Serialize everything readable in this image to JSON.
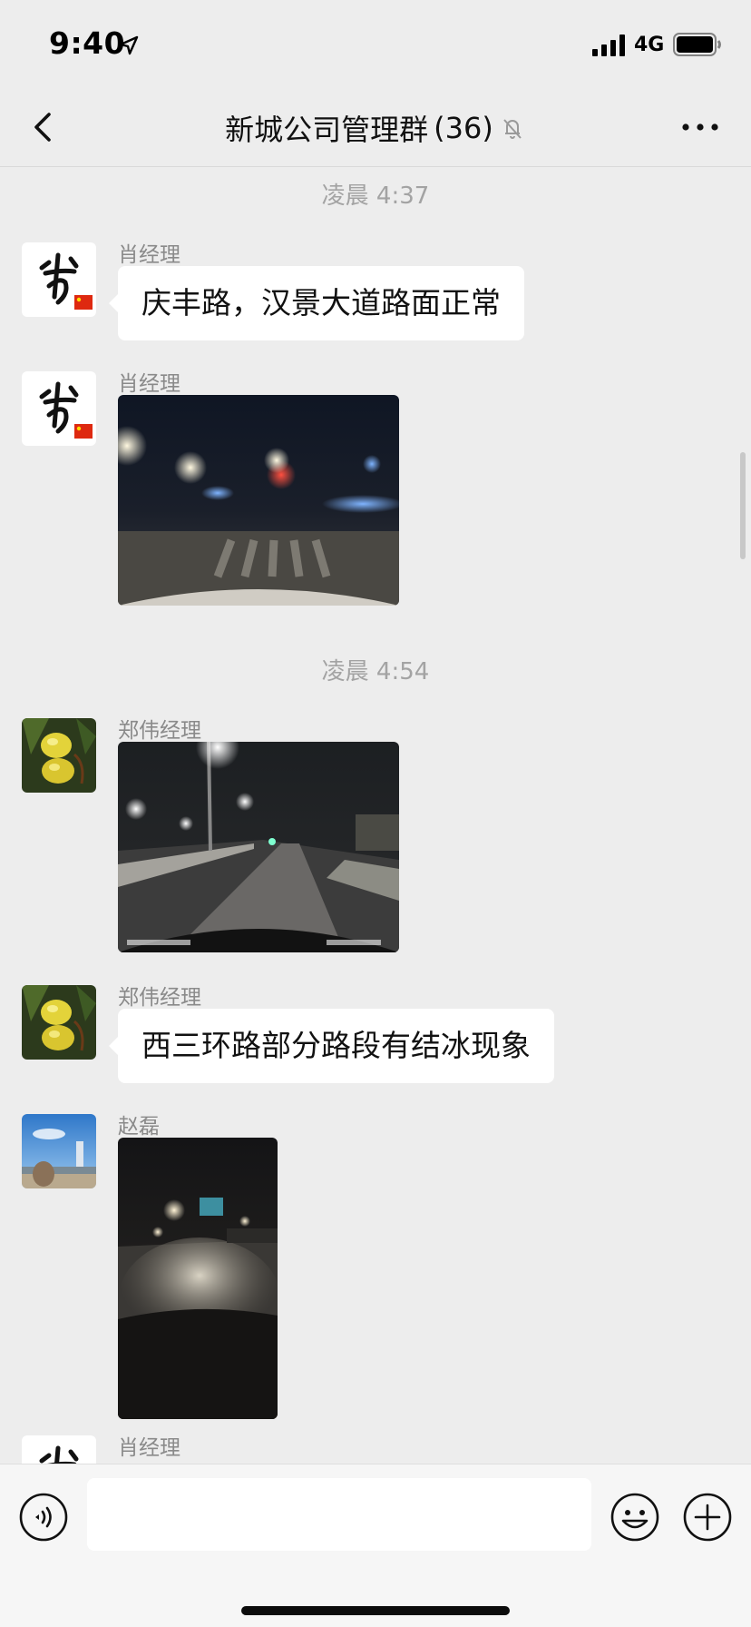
{
  "status_bar": {
    "time": "9:40",
    "network": "4G"
  },
  "nav": {
    "title": "新城公司管理群",
    "member_count": "(36)"
  },
  "chat": {
    "time_separators": [
      "凌晨 4:37",
      "凌晨 4:54"
    ],
    "messages": [
      {
        "sender": "肖经理",
        "type": "text",
        "text": "庆丰路，汉景大道路面正常",
        "avatar": "signature-avatar"
      },
      {
        "sender": "肖经理",
        "type": "image",
        "image": "night-intersection-photo",
        "avatar": "signature-avatar"
      },
      {
        "sender": "郑伟经理",
        "type": "image",
        "image": "night-road-streetlights-photo",
        "avatar": "yellow-fruit-avatar"
      },
      {
        "sender": "郑伟经理",
        "type": "text",
        "text": "西三环路部分路段有结冰现象",
        "avatar": "yellow-fruit-avatar"
      },
      {
        "sender": "赵磊",
        "type": "image",
        "image": "night-road-headlights-photo",
        "avatar": "seaside-avatar"
      },
      {
        "sender": "肖经理",
        "type": "partial",
        "avatar": "signature-avatar"
      }
    ]
  },
  "input_bar": {
    "placeholder": ""
  },
  "colors": {
    "background": "#ededed",
    "bubble": "#ffffff",
    "accent_flag": "#de2910"
  }
}
